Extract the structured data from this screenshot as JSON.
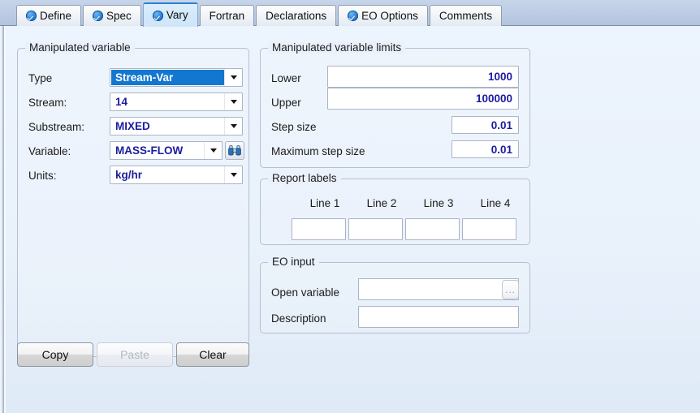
{
  "tabs": [
    {
      "label": "Define",
      "icon": "check-circle-icon",
      "checked": true,
      "active": false
    },
    {
      "label": "Spec",
      "icon": "check-circle-icon",
      "checked": true,
      "active": false
    },
    {
      "label": "Vary",
      "icon": "check-circle-icon",
      "checked": true,
      "active": true
    },
    {
      "label": "Fortran",
      "icon": "",
      "checked": false,
      "active": false
    },
    {
      "label": "Declarations",
      "icon": "",
      "checked": false,
      "active": false
    },
    {
      "label": "EO Options",
      "icon": "check-circle-icon",
      "checked": true,
      "active": false
    },
    {
      "label": "Comments",
      "icon": "",
      "checked": false,
      "active": false
    }
  ],
  "manipulated_variable": {
    "title": "Manipulated variable",
    "rows": [
      {
        "label": "Type",
        "value": "Stream-Var",
        "selected": true
      },
      {
        "label": "Stream:",
        "value": "14",
        "selected": false
      },
      {
        "label": "Substream:",
        "value": "MIXED",
        "selected": false
      },
      {
        "label": "Variable:",
        "value": "MASS-FLOW",
        "selected": false
      },
      {
        "label": "Units:",
        "value": "kg/hr",
        "selected": false
      }
    ],
    "find_icon": "binoculars-icon"
  },
  "limits": {
    "title": "Manipulated variable limits",
    "lower_label": "Lower",
    "lower_value": "1000",
    "upper_label": "Upper",
    "upper_value": "100000",
    "step_label": "Step size",
    "step_value": "0.01",
    "max_step_label": "Maximum step size",
    "max_step_value": "0.01"
  },
  "report_labels": {
    "title": "Report labels",
    "columns": [
      "Line 1",
      "Line 2",
      "Line 3",
      "Line 4"
    ],
    "values": [
      "",
      "",
      "",
      ""
    ]
  },
  "eo_input": {
    "title": "EO input",
    "open_variable_label": "Open variable",
    "open_variable_value": "",
    "browse_label": "...",
    "description_label": "Description",
    "description_value": ""
  },
  "buttons": {
    "copy": "Copy",
    "paste": "Paste",
    "clear": "Clear"
  },
  "colors": {
    "accent": "#1376cf",
    "value_text": "#1b1c9e",
    "tabbar": "#bccce4",
    "canvas": "#eaf1fb"
  }
}
